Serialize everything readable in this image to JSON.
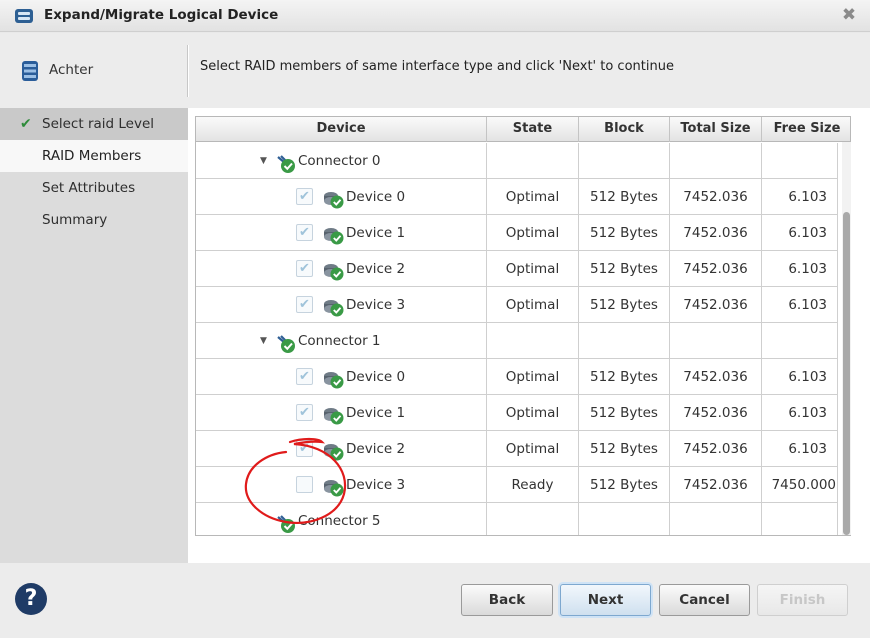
{
  "window": {
    "title": "Expand/Migrate Logical Device",
    "close_glyph": "✖"
  },
  "header": {
    "server_name": "Achter",
    "instruction": "Select RAID members of same interface type and click 'Next' to continue"
  },
  "steps": [
    {
      "label": "Select raid Level",
      "state": "done"
    },
    {
      "label": "RAID Members",
      "state": "active"
    },
    {
      "label": "Set Attributes",
      "state": "pending"
    },
    {
      "label": "Summary",
      "state": "pending"
    }
  ],
  "table": {
    "columns": [
      "Device",
      "State",
      "Block",
      "Total Size",
      "Free Size"
    ],
    "rows": [
      {
        "type": "connector",
        "label": "Connector 0",
        "expanded": true
      },
      {
        "type": "device",
        "label": "Device 0",
        "checked": true,
        "state": "Optimal",
        "block": "512 Bytes",
        "total": "7452.036",
        "free": "6.103"
      },
      {
        "type": "device",
        "label": "Device 1",
        "checked": true,
        "state": "Optimal",
        "block": "512 Bytes",
        "total": "7452.036",
        "free": "6.103"
      },
      {
        "type": "device",
        "label": "Device 2",
        "checked": true,
        "state": "Optimal",
        "block": "512 Bytes",
        "total": "7452.036",
        "free": "6.103"
      },
      {
        "type": "device",
        "label": "Device 3",
        "checked": true,
        "state": "Optimal",
        "block": "512 Bytes",
        "total": "7452.036",
        "free": "6.103"
      },
      {
        "type": "connector",
        "label": "Connector 1",
        "expanded": true
      },
      {
        "type": "device",
        "label": "Device 0",
        "checked": true,
        "state": "Optimal",
        "block": "512 Bytes",
        "total": "7452.036",
        "free": "6.103"
      },
      {
        "type": "device",
        "label": "Device 1",
        "checked": true,
        "state": "Optimal",
        "block": "512 Bytes",
        "total": "7452.036",
        "free": "6.103"
      },
      {
        "type": "device",
        "label": "Device 2",
        "checked": true,
        "state": "Optimal",
        "block": "512 Bytes",
        "total": "7452.036",
        "free": "6.103"
      },
      {
        "type": "device",
        "label": "Device 3",
        "checked": false,
        "state": "Ready",
        "block": "512 Bytes",
        "total": "7452.036",
        "free": "7450.000"
      },
      {
        "type": "connector",
        "label": "Connector 5",
        "expanded": false
      }
    ]
  },
  "buttons": {
    "help": "?",
    "back": "Back",
    "next": "Next",
    "cancel": "Cancel",
    "finish": "Finish"
  },
  "colors": {
    "accent": "#1f3b66",
    "check_green": "#2e8b3a",
    "annotation_red": "#e01b1b"
  }
}
